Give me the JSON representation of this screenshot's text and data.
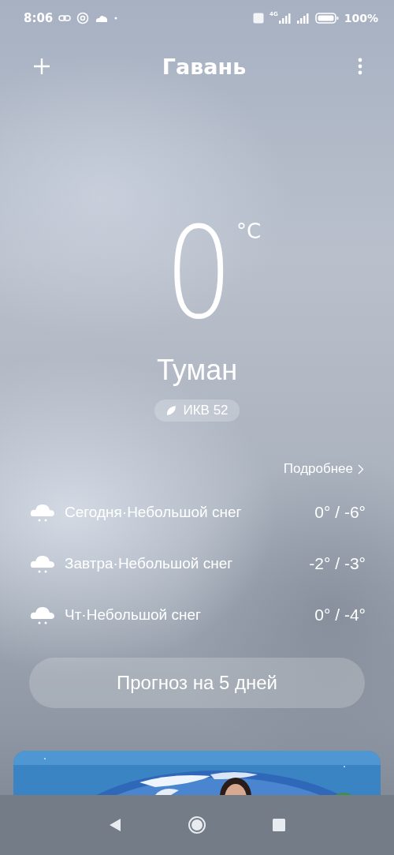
{
  "status_bar": {
    "time": "8:06",
    "network": "4G",
    "battery": "100%"
  },
  "header": {
    "title": "Гавань"
  },
  "current": {
    "temperature": "0",
    "unit": "°C",
    "condition": "Туман",
    "aqi": "ИКВ 52"
  },
  "details_link": "Подробнее",
  "forecast": [
    {
      "label": "Сегодня·Небольшой снег",
      "temps": "0° / -6°"
    },
    {
      "label": "Завтра·Небольшой снег",
      "temps": "-2° / -3°"
    },
    {
      "label": "Чт·Небольшой снег",
      "temps": "0° / -4°"
    }
  ],
  "forecast_button": "Прогноз на 5 дней"
}
